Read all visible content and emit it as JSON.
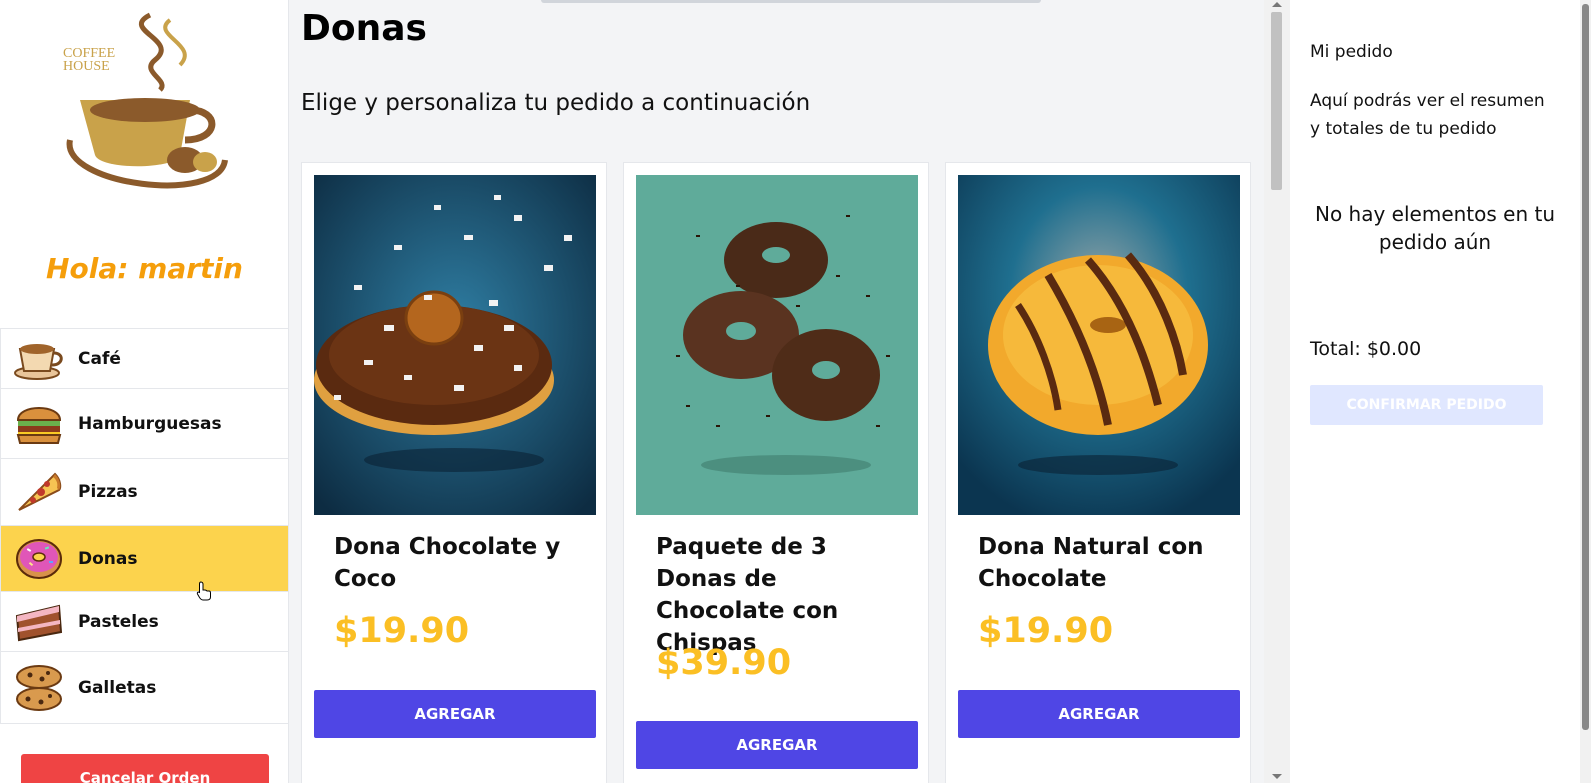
{
  "sidebar": {
    "logo_text_1": "COFFEE",
    "logo_text_2": "HOUSE",
    "greeting": "Hola: martin",
    "categories": [
      {
        "label": "Café",
        "icon": "coffee-cup-icon"
      },
      {
        "label": "Hamburguesas",
        "icon": "burger-icon"
      },
      {
        "label": "Pizzas",
        "icon": "pizza-icon"
      },
      {
        "label": "Donas",
        "icon": "donut-icon",
        "active": true
      },
      {
        "label": "Pasteles",
        "icon": "cake-icon"
      },
      {
        "label": "Galletas",
        "icon": "cookies-icon"
      }
    ],
    "cancel_label": "Cancelar Orden"
  },
  "main": {
    "title": "Donas",
    "subtitle": "Elige y personaliza tu pedido a continuación",
    "products": [
      {
        "name": "Dona Chocolate y Coco",
        "price": "$19.90",
        "button": "AGREGAR"
      },
      {
        "name": "Paquete de 3 Donas de Chocolate con Chispas",
        "price": "$39.90",
        "button": "AGREGAR"
      },
      {
        "name": "Dona Natural con Chocolate",
        "price": "$19.90",
        "button": "AGREGAR"
      }
    ]
  },
  "order": {
    "title": "Mi pedido",
    "description": "Aquí podrás ver el resumen y totales de tu pedido",
    "empty": "No hay elementos en tu pedido aún",
    "total": "Total: $0.00",
    "confirm_label": "CONFIRMAR PEDIDO"
  },
  "colors": {
    "accent": "#4f46e5",
    "active_category": "#fcd34d",
    "price": "#fbbf24",
    "greeting": "#f59e0b",
    "cancel": "#ef4444"
  }
}
